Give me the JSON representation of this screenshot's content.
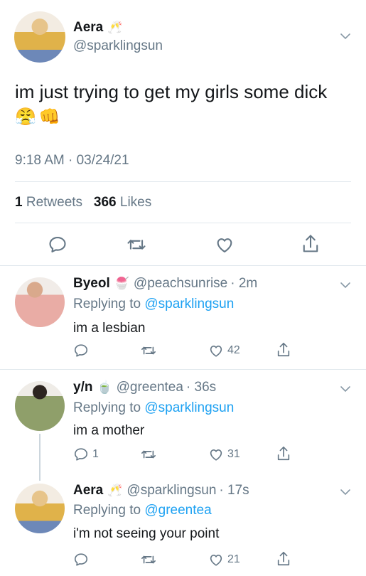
{
  "main_tweet": {
    "display_name": "Aera",
    "name_emoji": "🥂",
    "handle": "@sparklingsun",
    "text": "im just trying to get my girls some dick",
    "text_emoji": "😤👊",
    "timestamp": "9:18 AM · 03/24/21",
    "retweets_count": "1",
    "retweets_label": "Retweets",
    "likes_count": "366",
    "likes_label": "Likes"
  },
  "replies": [
    {
      "display_name": "Byeol",
      "name_emoji": "🍧",
      "handle": "@peachsunrise",
      "time": "· 2m",
      "replying_prefix": "Replying to",
      "replying_to": "@sparklingsun",
      "text": "im a lesbian",
      "reply_count": "",
      "like_count": "42"
    },
    {
      "display_name": "y/n",
      "name_emoji": "🍵",
      "handle": "@greentea",
      "time": "· 36s",
      "replying_prefix": "Replying to",
      "replying_to": "@sparklingsun",
      "text": "im a mother",
      "reply_count": "1",
      "like_count": "31"
    },
    {
      "display_name": "Aera",
      "name_emoji": "🥂",
      "handle": "@sparklingsun",
      "time": "· 17s",
      "replying_prefix": "Replying to",
      "replying_to": "@greentea",
      "text": "i'm not seeing your point",
      "reply_count": "",
      "like_count": "21"
    }
  ],
  "colors": {
    "link_blue": "#1da1f2",
    "secondary_gray": "#657786",
    "divider": "#e1e8ed"
  }
}
